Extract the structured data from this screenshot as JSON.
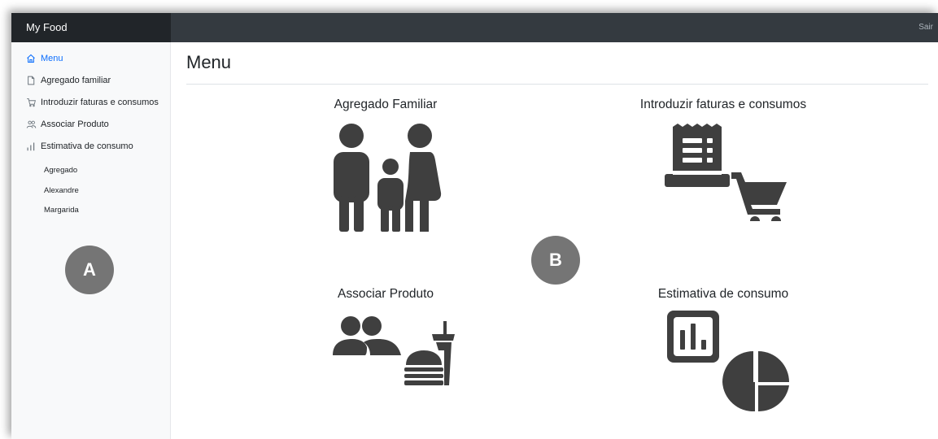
{
  "app": {
    "brand": "My Food",
    "signout_label": "Sair"
  },
  "sidebar": {
    "items": [
      {
        "label": "Menu",
        "icon": "home-icon",
        "active": true
      },
      {
        "label": "Agregado familiar",
        "icon": "file-icon"
      },
      {
        "label": "Introduzir faturas e consumos",
        "icon": "cart-icon"
      },
      {
        "label": "Associar Produto",
        "icon": "people-icon"
      },
      {
        "label": "Estimativa de consumo",
        "icon": "bar-chart-icon"
      }
    ],
    "subitems": [
      "Agregado",
      "Alexandre",
      "Margarida"
    ]
  },
  "annotations": {
    "a": "A",
    "b": "B"
  },
  "main": {
    "title": "Menu",
    "tiles": [
      {
        "label": "Agregado Familiar",
        "icon": "family-icon"
      },
      {
        "label": "Introduzir faturas e consumos",
        "icon": "receipt-cart-icon"
      },
      {
        "label": "Associar Produto",
        "icon": "people-food-icon"
      },
      {
        "label": "Estimativa de consumo",
        "icon": "chart-pie-icon"
      }
    ]
  },
  "colors": {
    "topbar": "#343a40",
    "brand_bg": "#212529",
    "sidebar_bg": "#f8f9fa",
    "active_link": "#0d6efd",
    "icon_dark": "#3f3f3f",
    "badge": "#757575"
  }
}
